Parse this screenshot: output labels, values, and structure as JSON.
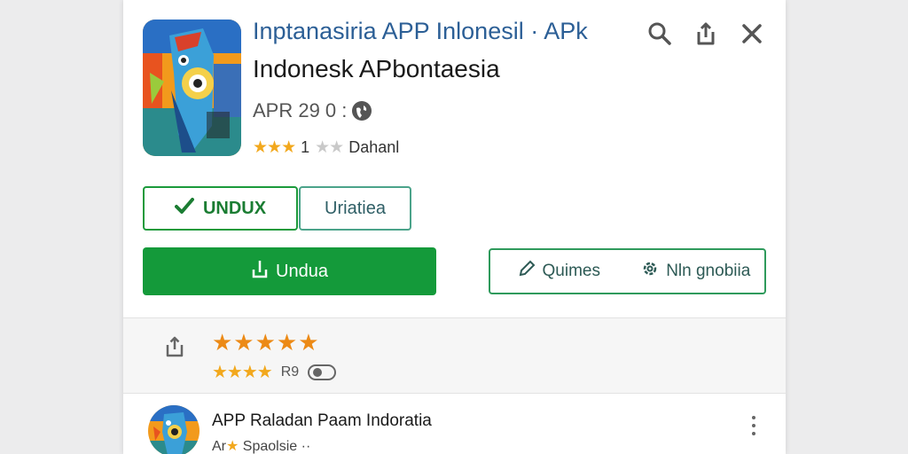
{
  "header": {
    "title_link": "Inptanasiria APP Inlonesil · APk",
    "app_name": "Indonesk APbontaesia",
    "version": "APR 29 0 :",
    "rating_stars": "★★★",
    "rating_value": "1",
    "rating_dim_stars": "★★",
    "rating_label": "Dahanl",
    "icons": [
      "search-icon",
      "share-icon",
      "close-icon"
    ]
  },
  "buttons": {
    "unduh_outline": "UNDUX",
    "uriatiea": "Uriatiea",
    "unduh_primary": "Undua",
    "split_left": "Quimes",
    "split_right": "Nln gnobiia"
  },
  "review": {
    "stars": "★★★★★",
    "sub_stars": "★★★★",
    "sub_label": "R9"
  },
  "list_item": {
    "title": "APP Raladan Paam Indoratia",
    "sub_prefix": "Ar",
    "sub_star": "★",
    "sub_label": "Spaolsie",
    "sub_dots": "··"
  },
  "colors": {
    "primary_green": "#149a3a",
    "link_blue": "#2c5f96",
    "star_orange": "#ec8a16"
  }
}
